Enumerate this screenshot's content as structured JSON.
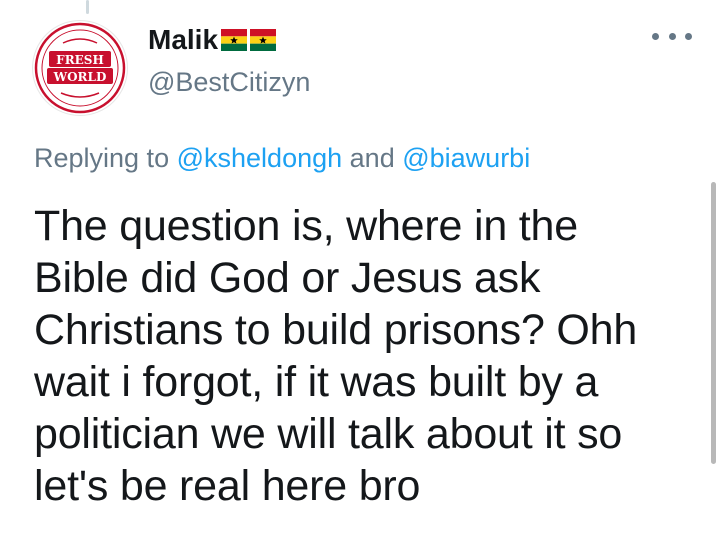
{
  "tweet": {
    "author": {
      "display_name": "Malik",
      "handle": "@BestCitizyn",
      "flag_emoji_name": "ghana-flag-icon",
      "flags": [
        {
          "colors": [
            "#ce1126",
            "#fcd116",
            "#006b3f"
          ],
          "star": "#000000"
        },
        {
          "colors": [
            "#ce1126",
            "#fcd116",
            "#006b3f"
          ],
          "star": "#000000"
        }
      ],
      "avatar": {
        "logo_top": "FRESH",
        "logo_bottom": "WORLD",
        "logo_color": "#c8102e"
      }
    },
    "replying_to_prefix": "Replying to",
    "replying_to": [
      "@ksheldongh",
      "@biawurbi"
    ],
    "replying_joiner": "and",
    "lines": [
      "The question is, where in the",
      "Bible did God or Jesus ask",
      "Christians to build prisons? Ohh",
      "wait i forgot, if it was built by a",
      "politician we will talk about it so",
      "let's be real here bro"
    ],
    "more_icon": "more-horizontal-icon"
  },
  "colors": {
    "link": "#1da1f2",
    "secondary_text": "#657786",
    "primary_text": "#14171a"
  }
}
